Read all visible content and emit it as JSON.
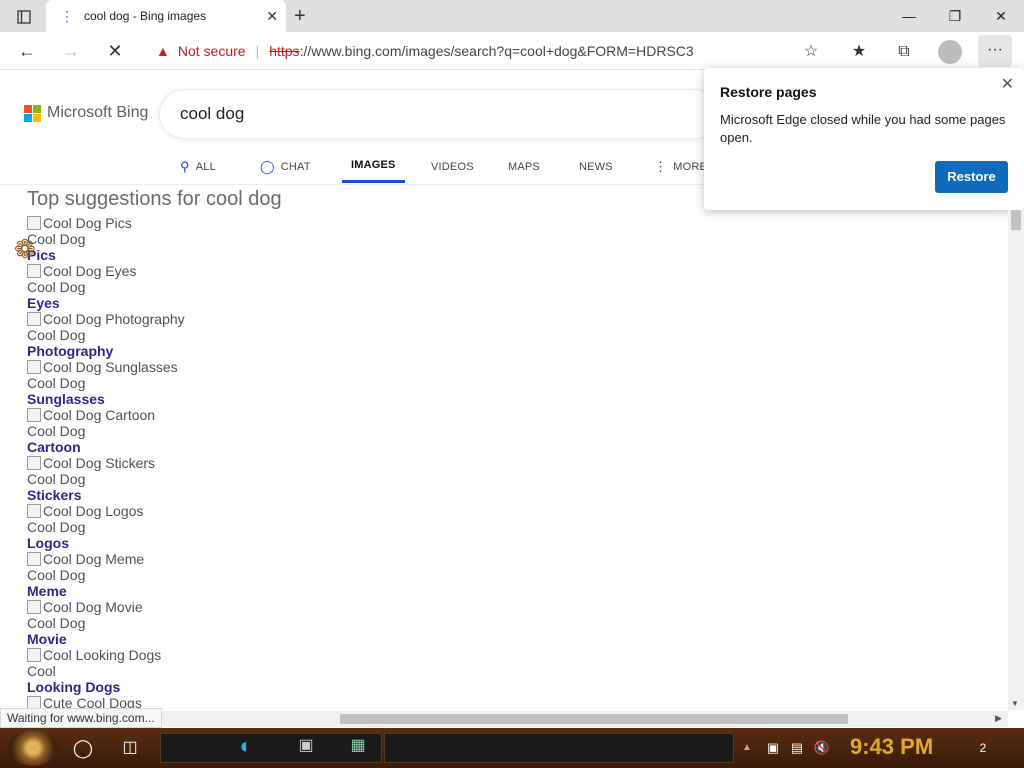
{
  "browser": {
    "tab_title": "cool dog - Bing images",
    "security_label": "Not secure",
    "url_protocol": "https",
    "url_rest": "://www.bing.com/images/search?q=cool+dog&FORM=HDRSC3"
  },
  "bing": {
    "logo_text": "Microsoft Bing",
    "query": "cool dog",
    "scopes": [
      "ALL",
      "CHAT",
      "IMAGES",
      "VIDEOS",
      "MAPS",
      "NEWS",
      "MORE"
    ],
    "active_scope": "IMAGES"
  },
  "suggestions": {
    "title": "Top suggestions for cool dog",
    "items": [
      {
        "alt": "Cool Dog Pics",
        "line1": "Cool Dog",
        "line2": "Pics"
      },
      {
        "alt": "Cool Dog Eyes",
        "line1": "Cool Dog",
        "line2": "Eyes"
      },
      {
        "alt": "Cool Dog Photography",
        "line1": "Cool Dog",
        "line2": "Photography"
      },
      {
        "alt": "Cool Dog Sunglasses",
        "line1": "Cool Dog",
        "line2": "Sunglasses"
      },
      {
        "alt": "Cool Dog Cartoon",
        "line1": "Cool Dog",
        "line2": "Cartoon"
      },
      {
        "alt": "Cool Dog Stickers",
        "line1": "Cool Dog",
        "line2": "Stickers"
      },
      {
        "alt": "Cool Dog Logos",
        "line1": "Cool Dog",
        "line2": "Logos"
      },
      {
        "alt": "Cool Dog Meme",
        "line1": "Cool Dog",
        "line2": "Meme"
      },
      {
        "alt": "Cool Dog Movie",
        "line1": "Cool Dog",
        "line2": "Movie"
      },
      {
        "alt": "Cool Looking Dogs",
        "line1": "Cool",
        "line2": "Looking Dogs"
      },
      {
        "alt": "Cute Cool Dogs",
        "line1": "",
        "line2": ""
      }
    ]
  },
  "popup": {
    "title": "Restore pages",
    "message": "Microsoft Edge closed while you had some pages open.",
    "button": "Restore"
  },
  "status": {
    "text": "Waiting for www.bing.com..."
  },
  "taskbar": {
    "clock": "9:43 PM",
    "notification_count": "2"
  },
  "colors": {
    "accent": "#174ae4",
    "link_visited": "#3b1e8a",
    "edge_button": "#0f6cbd",
    "warning": "#c41e1e",
    "taskbar": "#3a1a08",
    "clock": "#e3a832"
  }
}
